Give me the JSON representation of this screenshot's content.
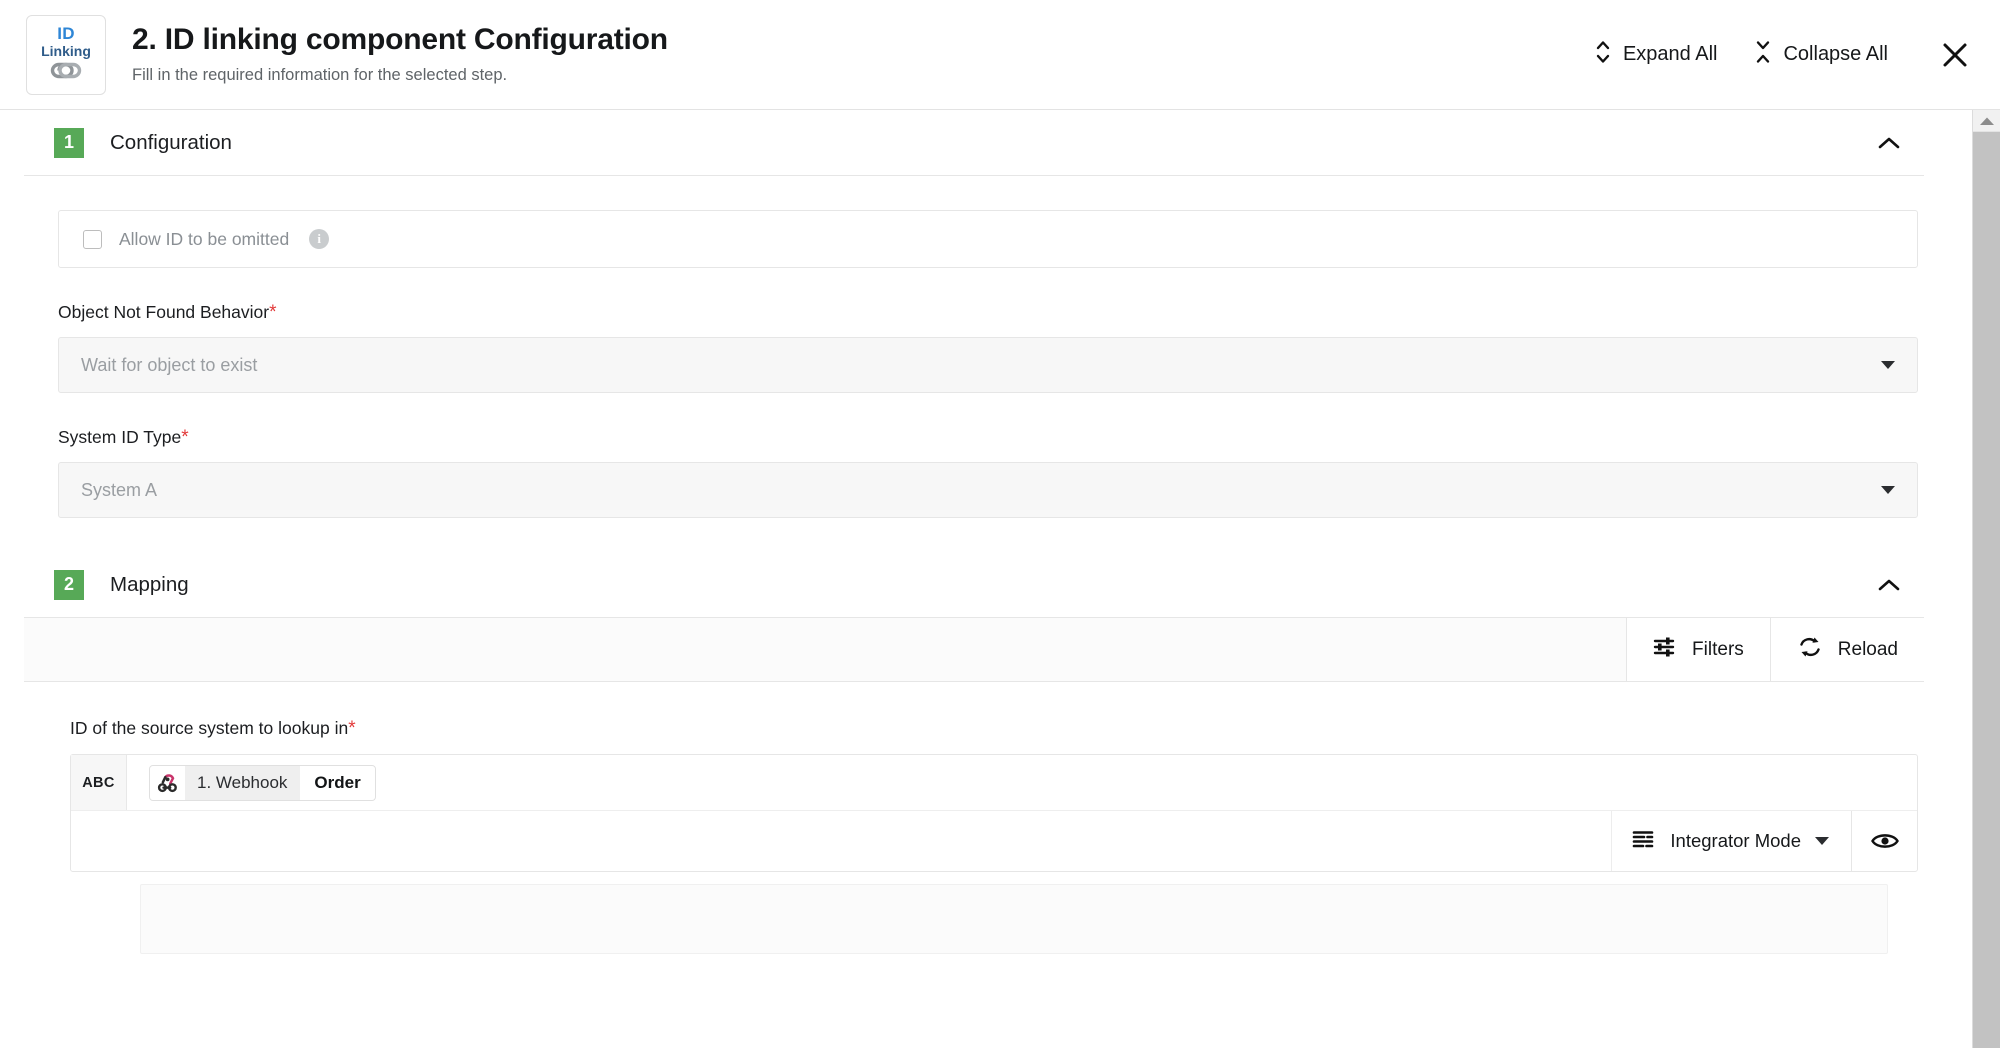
{
  "header": {
    "logo": {
      "top_text": "ID",
      "bottom_text": "Linking",
      "icon": "chain-links-icon"
    },
    "title": "2. ID linking component Configuration",
    "subtitle": "Fill in the required information for the selected step.",
    "expand_all_label": "Expand All",
    "collapse_all_label": "Collapse All",
    "close_label": "✕"
  },
  "sections": [
    {
      "number": "1",
      "title": "Configuration",
      "checkbox": {
        "label": "Allow ID to be omitted",
        "checked": false,
        "info_glyph": "i"
      },
      "fields": [
        {
          "label": "Object Not Found Behavior",
          "required_marker": "*",
          "value": "Wait for object to exist",
          "placeholder": "Wait for object to exist"
        },
        {
          "label": "System ID Type",
          "required_marker": "*",
          "value": "System A",
          "placeholder": "System A"
        }
      ]
    },
    {
      "number": "2",
      "title": "Mapping",
      "toolbar": {
        "filters_label": "Filters",
        "reload_label": "Reload"
      },
      "mapping_field": {
        "label": "ID of the source system to lookup in",
        "required_marker": "*",
        "type_badge": "ABC",
        "token": {
          "icon": "webhook-icon",
          "step": "1. Webhook",
          "name": "Order"
        },
        "mode_label": "Integrator Mode",
        "preview_icon": "eye-icon"
      }
    }
  ],
  "colors": {
    "badge_green": "#57a957",
    "required_red": "#e23a3a",
    "logo_blue": "#2e86d6",
    "logo_navy": "#2f5c8a",
    "webhook_pink": "#c9346b",
    "webhook_dark": "#2b2b2b"
  },
  "scrollbar": {
    "position": "top"
  }
}
